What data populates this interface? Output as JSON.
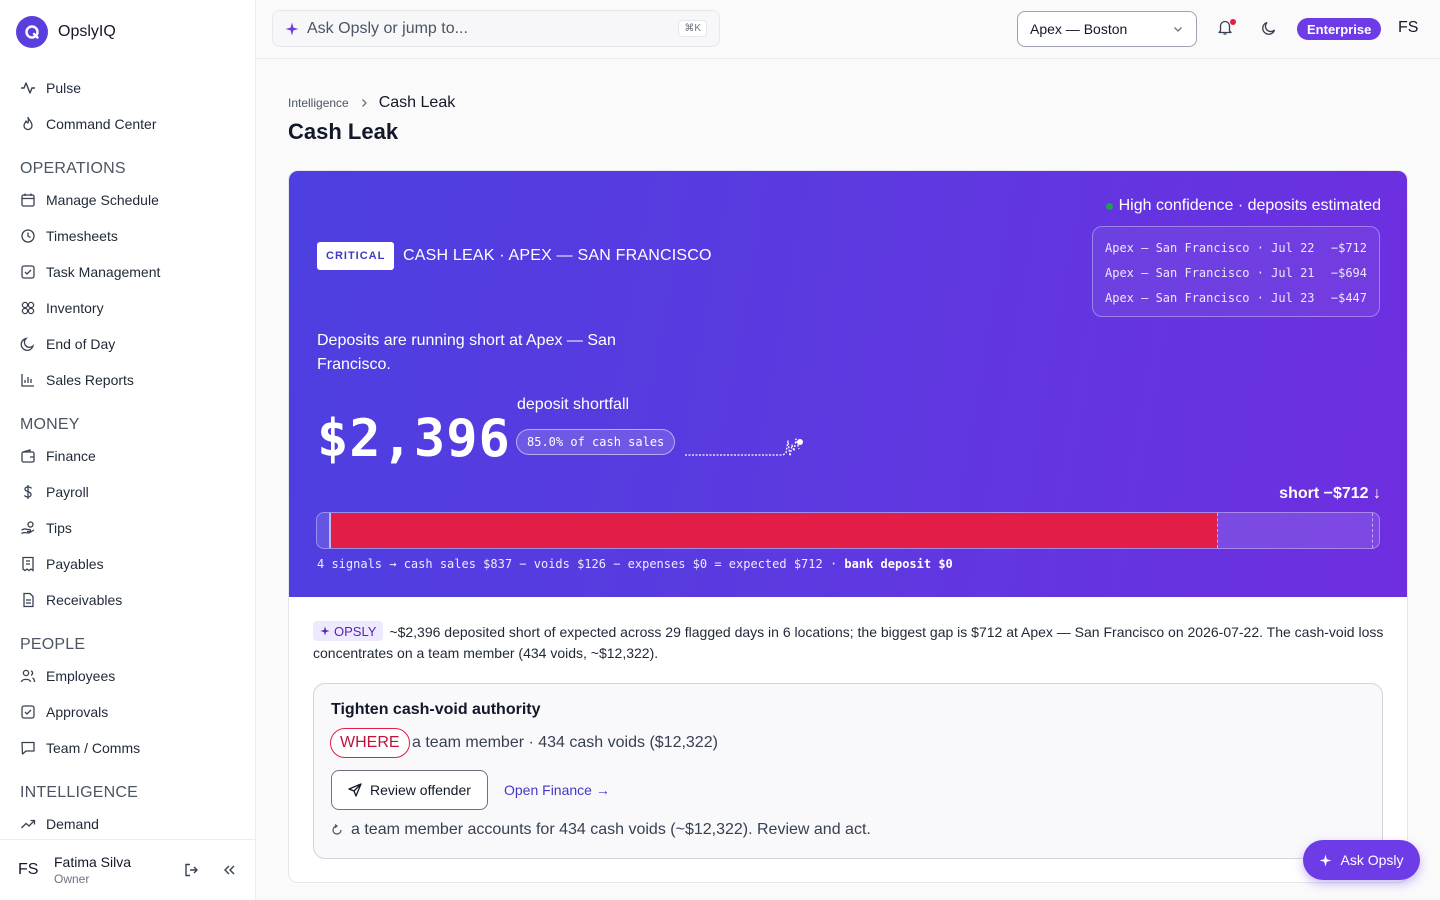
{
  "app": {
    "name": "OpslyIQ"
  },
  "sidebar": {
    "top_items": [
      {
        "label": "Pulse",
        "icon": "pulse-icon"
      },
      {
        "label": "Command Center",
        "icon": "flame-icon"
      }
    ],
    "sections": [
      {
        "title": "OPERATIONS",
        "items": [
          {
            "label": "Manage Schedule",
            "icon": "calendar-icon"
          },
          {
            "label": "Timesheets",
            "icon": "clock-icon"
          },
          {
            "label": "Task Management",
            "icon": "checkbox-icon"
          },
          {
            "label": "Inventory",
            "icon": "boxes-icon"
          },
          {
            "label": "End of Day",
            "icon": "moon-icon"
          },
          {
            "label": "Sales Reports",
            "icon": "bar-chart-icon"
          }
        ]
      },
      {
        "title": "MONEY",
        "items": [
          {
            "label": "Finance",
            "icon": "wallet-icon"
          },
          {
            "label": "Payroll",
            "icon": "dollar-icon"
          },
          {
            "label": "Tips",
            "icon": "hand-coins-icon"
          },
          {
            "label": "Payables",
            "icon": "receipt-icon"
          },
          {
            "label": "Receivables",
            "icon": "document-icon"
          }
        ]
      },
      {
        "title": "PEOPLE",
        "items": [
          {
            "label": "Employees",
            "icon": "users-icon"
          },
          {
            "label": "Approvals",
            "icon": "checkbox-icon"
          },
          {
            "label": "Team / Comms",
            "icon": "chat-icon"
          }
        ]
      },
      {
        "title": "INTELLIGENCE",
        "items": [
          {
            "label": "Demand",
            "icon": "trend-up-icon"
          }
        ]
      }
    ],
    "user": {
      "initials": "FS",
      "name": "Fatima Silva",
      "role": "Owner"
    }
  },
  "topbar": {
    "search_placeholder": "Ask Opsly or jump to...",
    "shortcut": "⌘K",
    "location": "Apex — Boston",
    "plan": "Enterprise",
    "initials": "FS"
  },
  "breadcrumb": {
    "parent": "Intelligence",
    "current": "Cash Leak"
  },
  "page_title": "Cash Leak",
  "hero": {
    "confidence": "High confidence · deposits estimated",
    "top_gaps": [
      {
        "location": "Apex — San Francisco · Jul 22",
        "amount": "−$712"
      },
      {
        "location": "Apex — San Francisco · Jul 21",
        "amount": "−$694"
      },
      {
        "location": "Apex — San Francisco · Jul 23",
        "amount": "−$447"
      }
    ],
    "severity": "CRITICAL",
    "alert_title": "CASH LEAK · APEX — SAN FRANCISCO",
    "summary": "Deposits are running short at Apex — San Francisco.",
    "amount": "$2,396",
    "amount_label": "deposit shortfall",
    "pct_label": "85.0% of cash sales",
    "short_label": "short −$712 ↓",
    "bar": {
      "cash_sales": 837,
      "voids": 126,
      "expenses": 0,
      "expected": 712,
      "deposit": 0
    },
    "formula": "4 signals → cash sales $837 − voids $126 − expenses $0 = expected $712 · ",
    "formula_bold": "bank deposit $0"
  },
  "insight": {
    "chip": "OPSLY",
    "text": "~$2,396 deposited short of expected across 29 flagged days in 6 locations; the biggest gap is $712 at Apex — San Francisco on 2026-07-22. The cash-void loss concentrates on a team member (434 voids, ~$12,322)."
  },
  "action": {
    "title": "Tighten cash-void authority",
    "where_label": "WHERE",
    "where_text": "a team member · 434 cash voids ($12,322)",
    "primary_button": "Review offender",
    "secondary_link": "Open Finance →",
    "note": "a team member accounts for 434 cash voids (~$12,322). Review and act."
  },
  "fab": {
    "label": "Ask Opsly"
  },
  "colors": {
    "accent": "#6d3ce6",
    "hero_start": "#4d3fe0",
    "hero_end": "#6e2ee0",
    "critical": "#e11d48"
  }
}
